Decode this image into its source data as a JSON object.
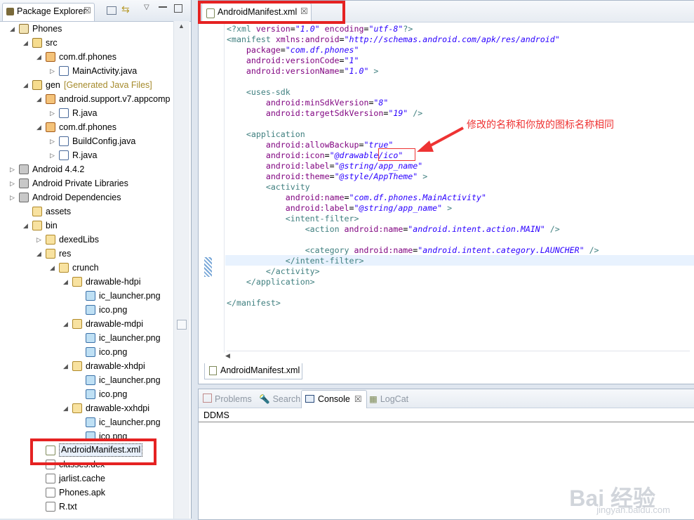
{
  "package_explorer": {
    "tab_label": "Package Explorer",
    "tree": [
      {
        "label": "Phones",
        "icon": "project-icon"
      },
      {
        "label": "src",
        "icon": "source-folder-icon"
      },
      {
        "label": "com.df.phones",
        "icon": "package-icon"
      },
      {
        "label": "MainActivity.java",
        "icon": "java-file-icon"
      },
      {
        "label": "gen",
        "note": "[Generated Java Files]",
        "icon": "source-folder-icon"
      },
      {
        "label": "android.support.v7.appcomp",
        "icon": "package-icon"
      },
      {
        "label": "R.java",
        "icon": "java-file-icon"
      },
      {
        "label": "com.df.phones",
        "icon": "package-icon"
      },
      {
        "label": "BuildConfig.java",
        "icon": "java-file-icon"
      },
      {
        "label": "R.java",
        "icon": "java-file-icon"
      },
      {
        "label": "Android 4.4.2",
        "icon": "library-icon"
      },
      {
        "label": "Android Private Libraries",
        "icon": "library-icon"
      },
      {
        "label": "Android Dependencies",
        "icon": "library-icon"
      },
      {
        "label": "assets",
        "icon": "folder-icon"
      },
      {
        "label": "bin",
        "icon": "folder-icon"
      },
      {
        "label": "dexedLibs",
        "icon": "folder-icon"
      },
      {
        "label": "res",
        "icon": "folder-icon"
      },
      {
        "label": "crunch",
        "icon": "folder-icon"
      },
      {
        "label": "drawable-hdpi",
        "icon": "folder-icon"
      },
      {
        "label": "ic_launcher.png",
        "icon": "image-file-icon"
      },
      {
        "label": "ico.png",
        "icon": "image-file-icon"
      },
      {
        "label": "drawable-mdpi",
        "icon": "folder-icon"
      },
      {
        "label": "ic_launcher.png",
        "icon": "image-file-icon"
      },
      {
        "label": "ico.png",
        "icon": "image-file-icon"
      },
      {
        "label": "drawable-xhdpi",
        "icon": "folder-icon"
      },
      {
        "label": "ic_launcher.png",
        "icon": "image-file-icon"
      },
      {
        "label": "ico.png",
        "icon": "image-file-icon"
      },
      {
        "label": "drawable-xxhdpi",
        "icon": "folder-icon"
      },
      {
        "label": "ic_launcher.png",
        "icon": "image-file-icon"
      },
      {
        "label": "ico.png",
        "icon": "image-file-icon"
      },
      {
        "label": "AndroidManifest.xml",
        "icon": "xml-file-icon"
      },
      {
        "label": "classes.dex",
        "icon": "file-icon"
      },
      {
        "label": "jarlist.cache",
        "icon": "file-icon"
      },
      {
        "label": "Phones.apk",
        "icon": "file-icon"
      },
      {
        "label": "R.txt",
        "icon": "file-icon"
      }
    ]
  },
  "editor": {
    "tab_label": "AndroidManifest.xml",
    "bottom_tab_label": "AndroidManifest.xml",
    "code_lines": [
      "<?xml version=\"1.0\" encoding=\"utf-8\"?>",
      "<manifest xmlns:android=\"http://schemas.android.com/apk/res/android\"",
      "    package=\"com.df.phones\"",
      "    android:versionCode=\"1\"",
      "    android:versionName=\"1.0\" >",
      "",
      "    <uses-sdk",
      "        android:minSdkVersion=\"8\"",
      "        android:targetSdkVersion=\"19\" />",
      "",
      "    <application",
      "        android:allowBackup=\"true\"",
      "        android:icon=\"@drawable/ico\"",
      "        android:label=\"@string/app_name\"",
      "        android:theme=\"@style/AppTheme\" >",
      "        <activity",
      "            android:name=\"com.df.phones.MainActivity\"",
      "            android:label=\"@string/app_name\" >",
      "            <intent-filter>",
      "                <action android:name=\"android.intent.action.MAIN\" />",
      "",
      "                <category android:name=\"android.intent.category.LAUNCHER\" />",
      "            </intent-filter>",
      "        </activity>",
      "    </application>",
      "",
      "</manifest>"
    ],
    "annotation": "修改的名称和你放的图标名称相同"
  },
  "console": {
    "tabs": [
      "Problems",
      "Search",
      "Console",
      "LogCat"
    ],
    "active_tab": "Console",
    "text": "DDMS"
  },
  "watermark": {
    "logo": "Bai 经验",
    "url": "jingyan.baidu.com"
  },
  "colors": {
    "highlight_box": "#e52222",
    "annotation": "#e33333"
  }
}
